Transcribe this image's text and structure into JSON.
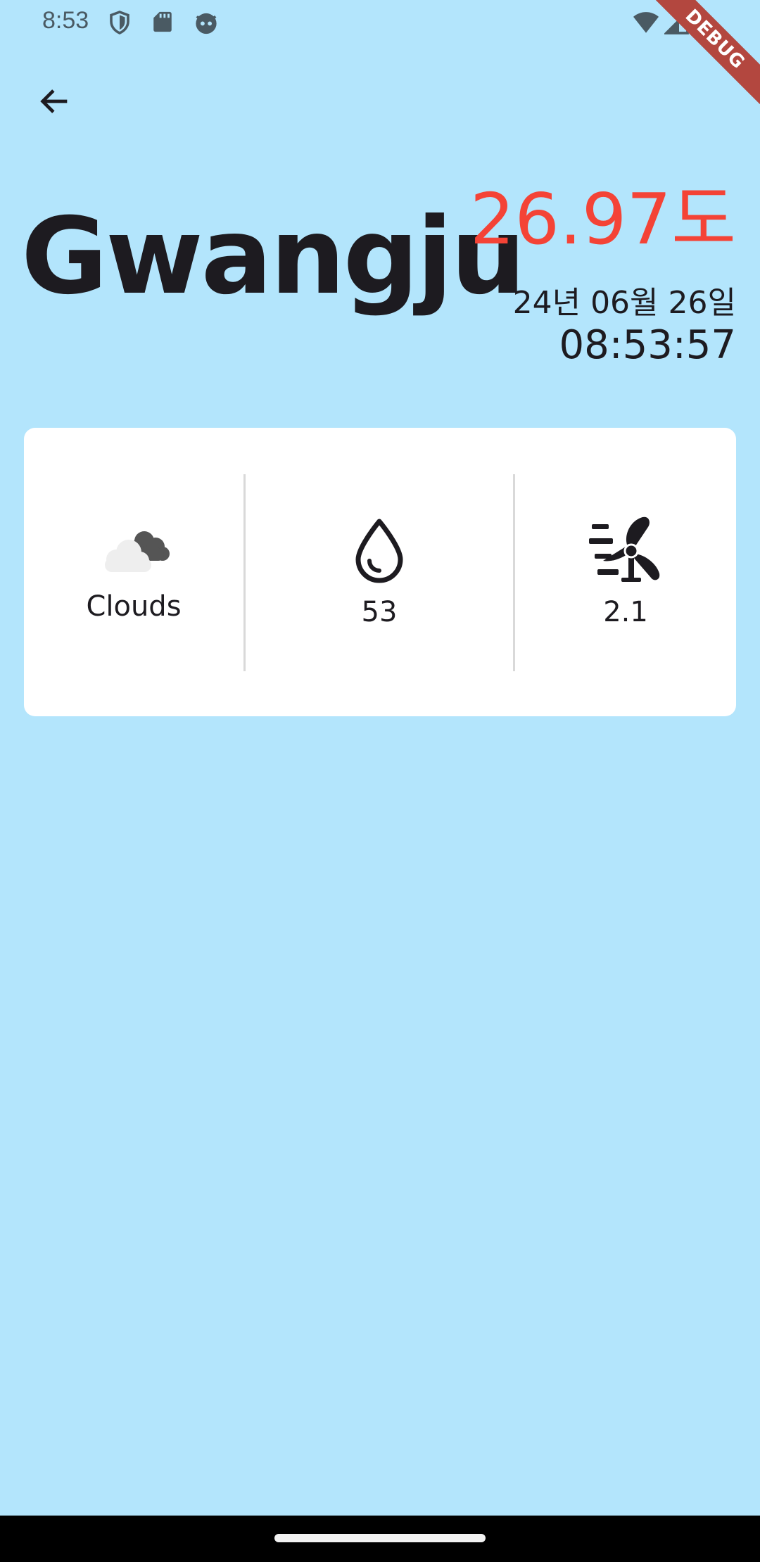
{
  "status_bar": {
    "time": "8:53",
    "icons_left": [
      "shield-icon",
      "sd-card-icon",
      "face-icon"
    ],
    "icons_right": [
      "wifi-icon",
      "signal-icon"
    ]
  },
  "debug_banner": "DEBUG",
  "header": {
    "city": "Gwangju",
    "temperature": "26.97도",
    "date": "24년 06월 26일",
    "time": "08:53:57"
  },
  "card": {
    "weather": {
      "icon": "clouds-icon",
      "label": "Clouds"
    },
    "humidity": {
      "icon": "water-drop-icon",
      "value": "53"
    },
    "wind": {
      "icon": "wind-turbine-icon",
      "value": "2.1"
    }
  },
  "colors": {
    "background": "#b3e5fc",
    "temperature": "#f44336",
    "card": "#ffffff",
    "text": "#1d1b20",
    "debug_ribbon": "#b3473f"
  }
}
